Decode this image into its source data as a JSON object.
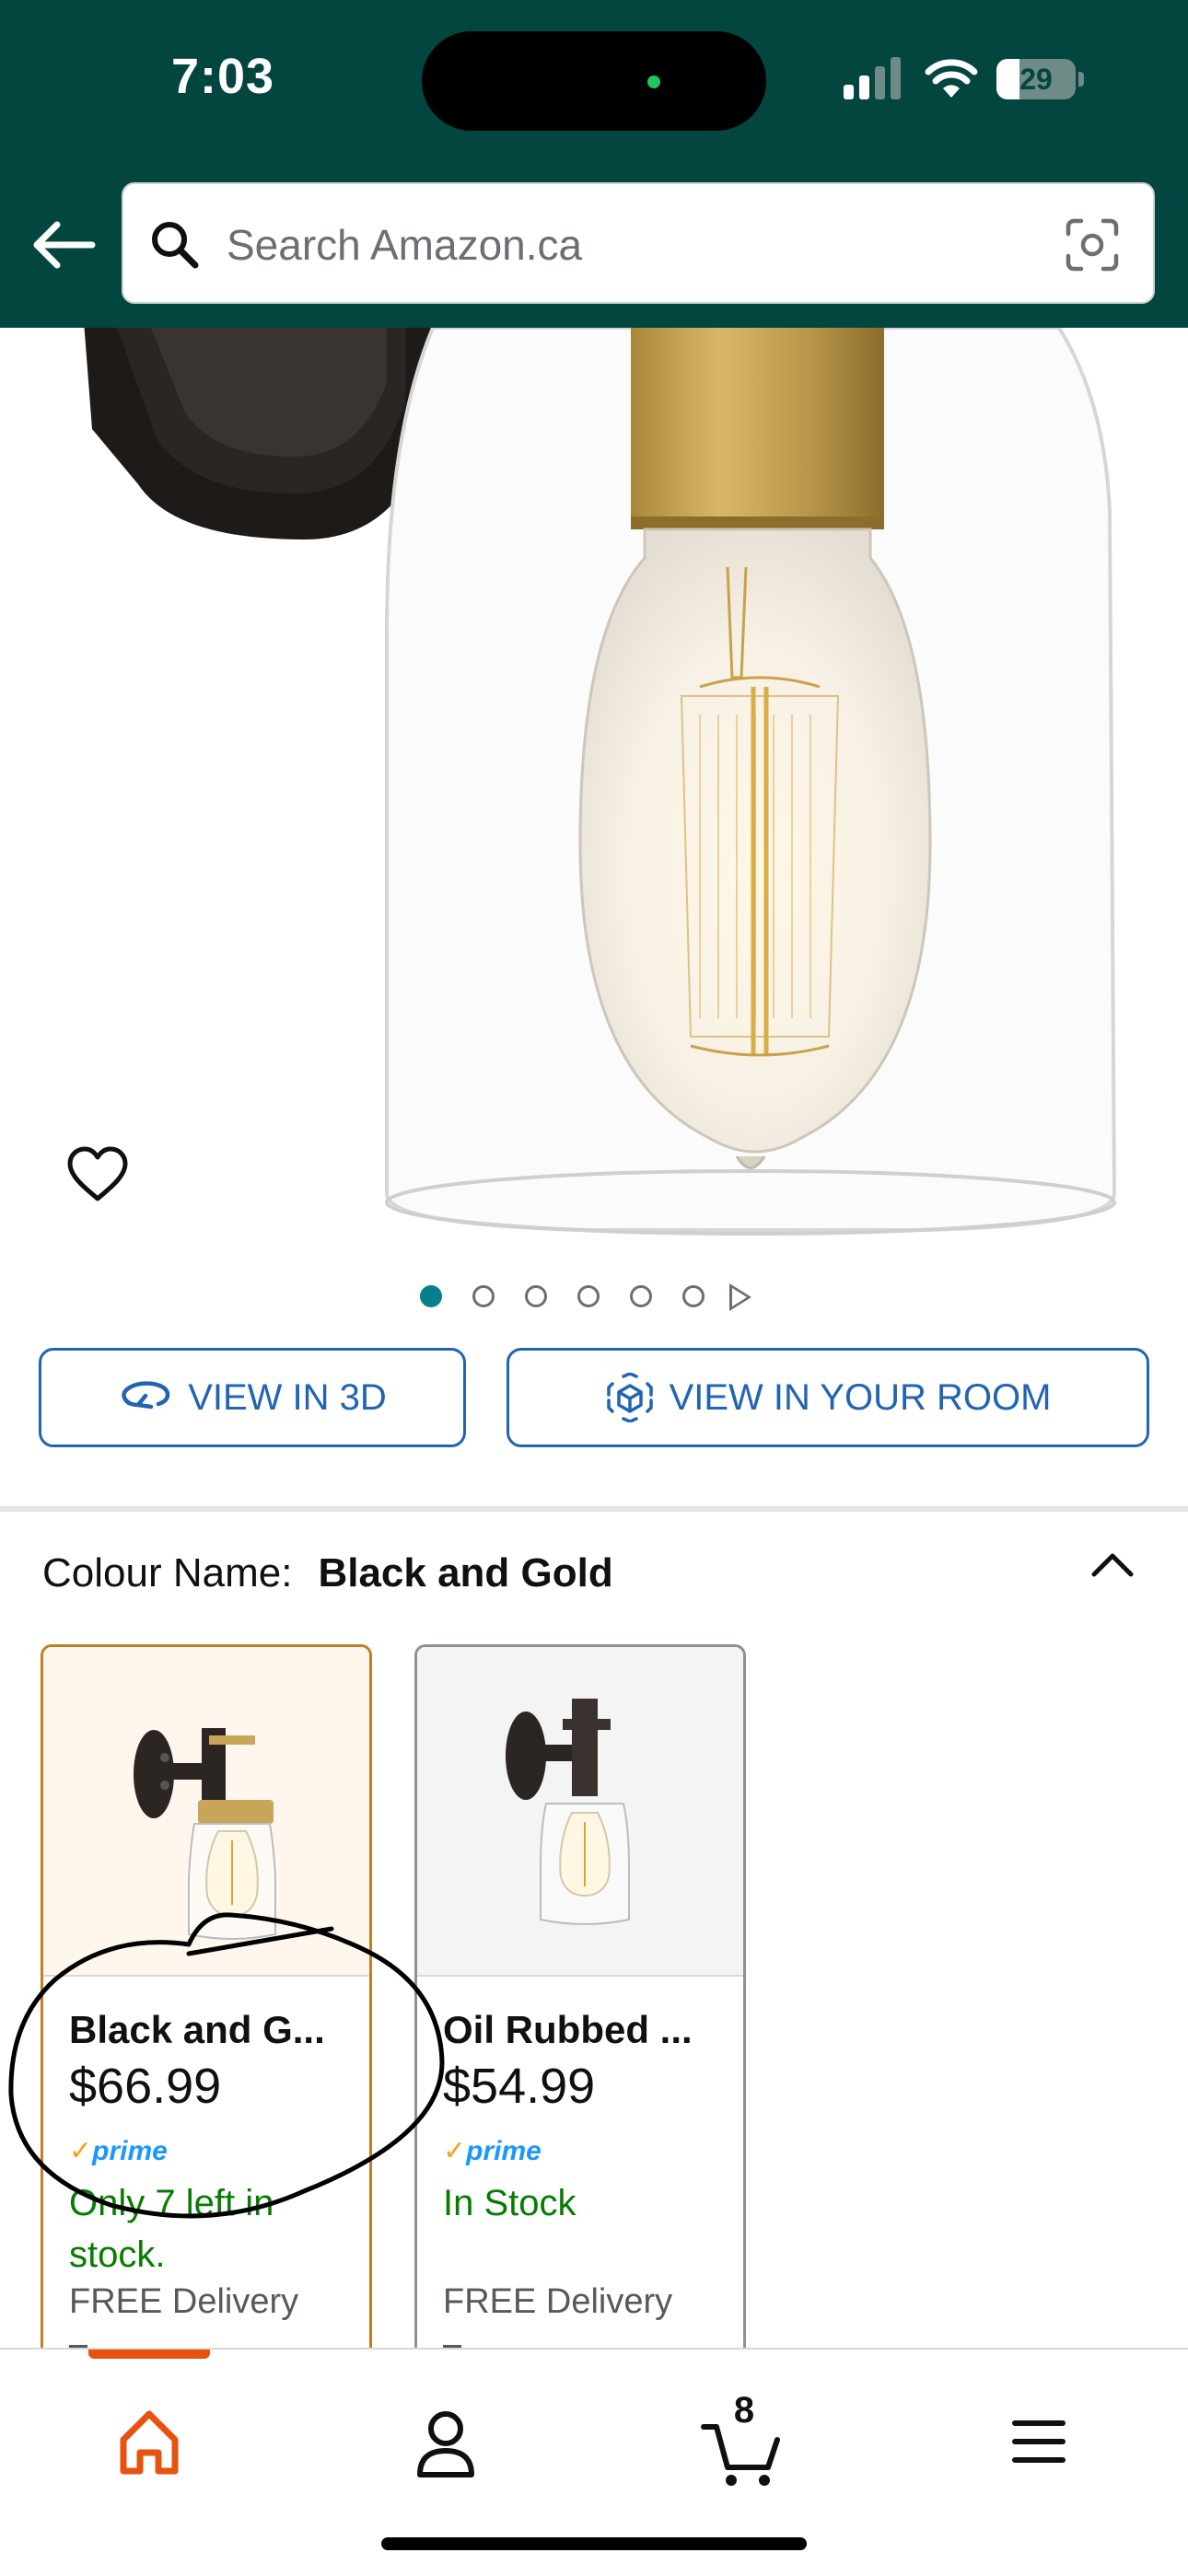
{
  "status_bar": {
    "time": "7:03",
    "battery": "29",
    "battery_level": 0.29
  },
  "header": {
    "search_placeholder": "Search Amazon.ca"
  },
  "product": {
    "image_count": 6,
    "active_image": 1,
    "view_3d_label": "VIEW IN 3D",
    "view_room_label": "VIEW IN YOUR ROOM"
  },
  "colour": {
    "label": "Colour Name:",
    "value": "Black and Gold"
  },
  "options": [
    {
      "name": "Black and G...",
      "price": "$66.99",
      "prime": "prime",
      "stock": "Only 7 left in stock.",
      "delivery": "FREE Delivery",
      "selected": true
    },
    {
      "name": "Oil Rubbed ...",
      "price": "$54.99",
      "prime": "prime",
      "stock": "In Stock",
      "delivery": "FREE Delivery",
      "selected": false
    }
  ],
  "bottom_nav": {
    "cart_count": "8",
    "active": "home"
  },
  "colors": {
    "header_bg": "#03453f",
    "link_blue": "#2064b2",
    "selected_border": "#c47e21",
    "in_stock_green": "#067d00",
    "nav_active": "#e7520f",
    "dot_active": "#087f8c"
  }
}
